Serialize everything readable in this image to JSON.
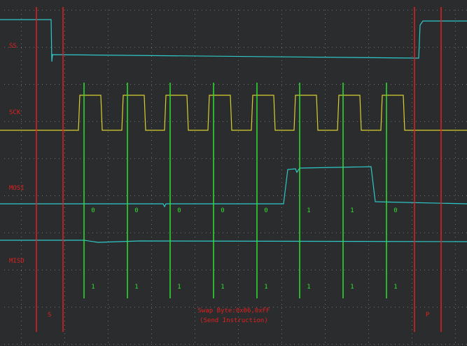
{
  "channels": {
    "ss": "SS",
    "sck": "SCK",
    "mosi": "MOSI",
    "miso": "MISO"
  },
  "markers": {
    "start": "S",
    "stop": "P"
  },
  "mosi_bits": [
    "0",
    "0",
    "0",
    "0",
    "0",
    "1",
    "1",
    "0"
  ],
  "miso_bits": [
    "1",
    "1",
    "1",
    "1",
    "1",
    "1",
    "1",
    "1"
  ],
  "decode": {
    "line1": "Swap Byte:0x06,0xFF",
    "line2": "(Send Instruction)"
  },
  "colors": {
    "background": "#2b2c2d",
    "grid": "#6b6f72",
    "ss_trace": "#2ec8c8",
    "sck_trace": "#d8d030",
    "mosi_trace": "#2ec8c8",
    "miso_trace": "#2ec8c8",
    "marker_lines": "#e02020",
    "bit_lines": "#2ee02e",
    "labels": "#e02020"
  }
}
